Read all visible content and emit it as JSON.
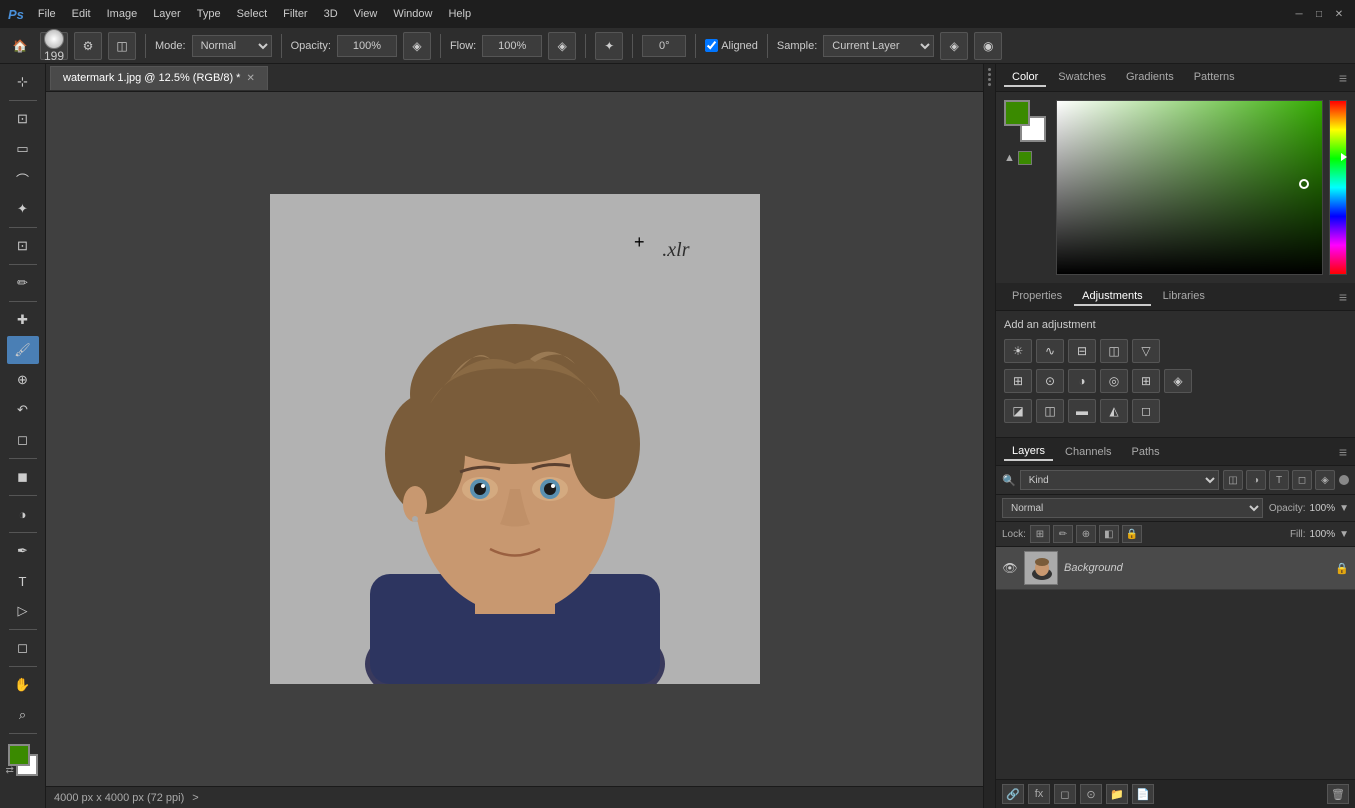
{
  "titlebar": {
    "logo": "Ps",
    "menu": [
      "File",
      "Edit",
      "Image",
      "Layer",
      "Type",
      "Select",
      "Filter",
      "3D",
      "View",
      "Window",
      "Help"
    ],
    "controls": [
      "─",
      "□",
      "✕"
    ]
  },
  "optionsbar": {
    "brush_size": "199",
    "mode_label": "Mode:",
    "mode_value": "Normal",
    "opacity_label": "Opacity:",
    "opacity_value": "100%",
    "flow_label": "Flow:",
    "flow_value": "100%",
    "angle_value": "0°",
    "aligned_label": "Aligned",
    "sample_label": "Sample:",
    "sample_value": "Current Layer"
  },
  "tab": {
    "filename": "watermark 1.jpg @ 12.5% (RGB/8) *",
    "close": "✕"
  },
  "statusbar": {
    "dimensions": "4000 px x 4000 px (72 ppi)",
    "arrow": ">"
  },
  "toolbar": {
    "tools": [
      {
        "name": "move",
        "icon": "⊹",
        "active": false
      },
      {
        "name": "artboard",
        "icon": "⊡",
        "active": false
      },
      {
        "name": "select-rect",
        "icon": "▭",
        "active": false
      },
      {
        "name": "lasso",
        "icon": "⌒",
        "active": false
      },
      {
        "name": "magic-wand",
        "icon": "✦",
        "active": false
      },
      {
        "name": "crop",
        "icon": "⊡",
        "active": false
      },
      {
        "name": "eyedropper",
        "icon": "✏",
        "active": false
      },
      {
        "name": "healing",
        "icon": "✚",
        "active": false
      },
      {
        "name": "brush",
        "icon": "⟡",
        "active": true
      },
      {
        "name": "clone-stamp",
        "icon": "⊕",
        "active": false
      },
      {
        "name": "eraser",
        "icon": "◻",
        "active": false
      },
      {
        "name": "gradient",
        "icon": "◼",
        "active": false
      },
      {
        "name": "dodge",
        "icon": "◑",
        "active": false
      },
      {
        "name": "pen",
        "icon": "✒",
        "active": false
      },
      {
        "name": "text",
        "icon": "T",
        "active": false
      },
      {
        "name": "path-select",
        "icon": "▷",
        "active": false
      },
      {
        "name": "shape",
        "icon": "◻",
        "active": false
      },
      {
        "name": "hand",
        "icon": "☚",
        "active": false
      },
      {
        "name": "zoom",
        "icon": "⌕",
        "active": false
      }
    ]
  },
  "colorpanel": {
    "tabs": [
      "Color",
      "Swatches",
      "Gradients",
      "Patterns"
    ],
    "active_tab": "Color",
    "fg_color": "#3a8a00",
    "bg_color": "#ffffff"
  },
  "adjustments": {
    "title": "Add an adjustment",
    "icons": [
      {
        "name": "brightness",
        "icon": "☀"
      },
      {
        "name": "curves",
        "icon": "∿"
      },
      {
        "name": "levels",
        "icon": "⊟"
      },
      {
        "name": "exposure",
        "icon": "◫"
      },
      {
        "name": "gradient-map",
        "icon": "▽"
      },
      {
        "name": "color-balance",
        "icon": "⊞"
      },
      {
        "name": "hue-sat",
        "icon": "⊙"
      },
      {
        "name": "black-white",
        "icon": "◑"
      },
      {
        "name": "photo-filter",
        "icon": "◎"
      },
      {
        "name": "channel-mixer",
        "icon": "⊞"
      },
      {
        "name": "color-lookup",
        "icon": "◈"
      },
      {
        "name": "invert",
        "icon": "◪"
      },
      {
        "name": "posterize",
        "icon": "◫"
      },
      {
        "name": "threshold",
        "icon": "▬"
      },
      {
        "name": "selective-color",
        "icon": "◭"
      },
      {
        "name": "vibrance",
        "icon": "◫"
      },
      {
        "name": "curves2",
        "icon": "◻"
      }
    ]
  },
  "layers": {
    "tabs": [
      "Layers",
      "Channels",
      "Paths"
    ],
    "active_tab": "Layers",
    "filter_placeholder": "Kind",
    "blend_mode": "Normal",
    "opacity_label": "Opacity:",
    "opacity_value": "100%",
    "lock_label": "Lock:",
    "fill_label": "Fill:",
    "fill_value": "100%",
    "items": [
      {
        "name": "Background",
        "visible": true,
        "locked": true
      }
    ],
    "bottom_buttons": [
      "link",
      "fx",
      "mask",
      "group",
      "new",
      "delete"
    ]
  },
  "watermark": {
    "text": ".xlr"
  }
}
